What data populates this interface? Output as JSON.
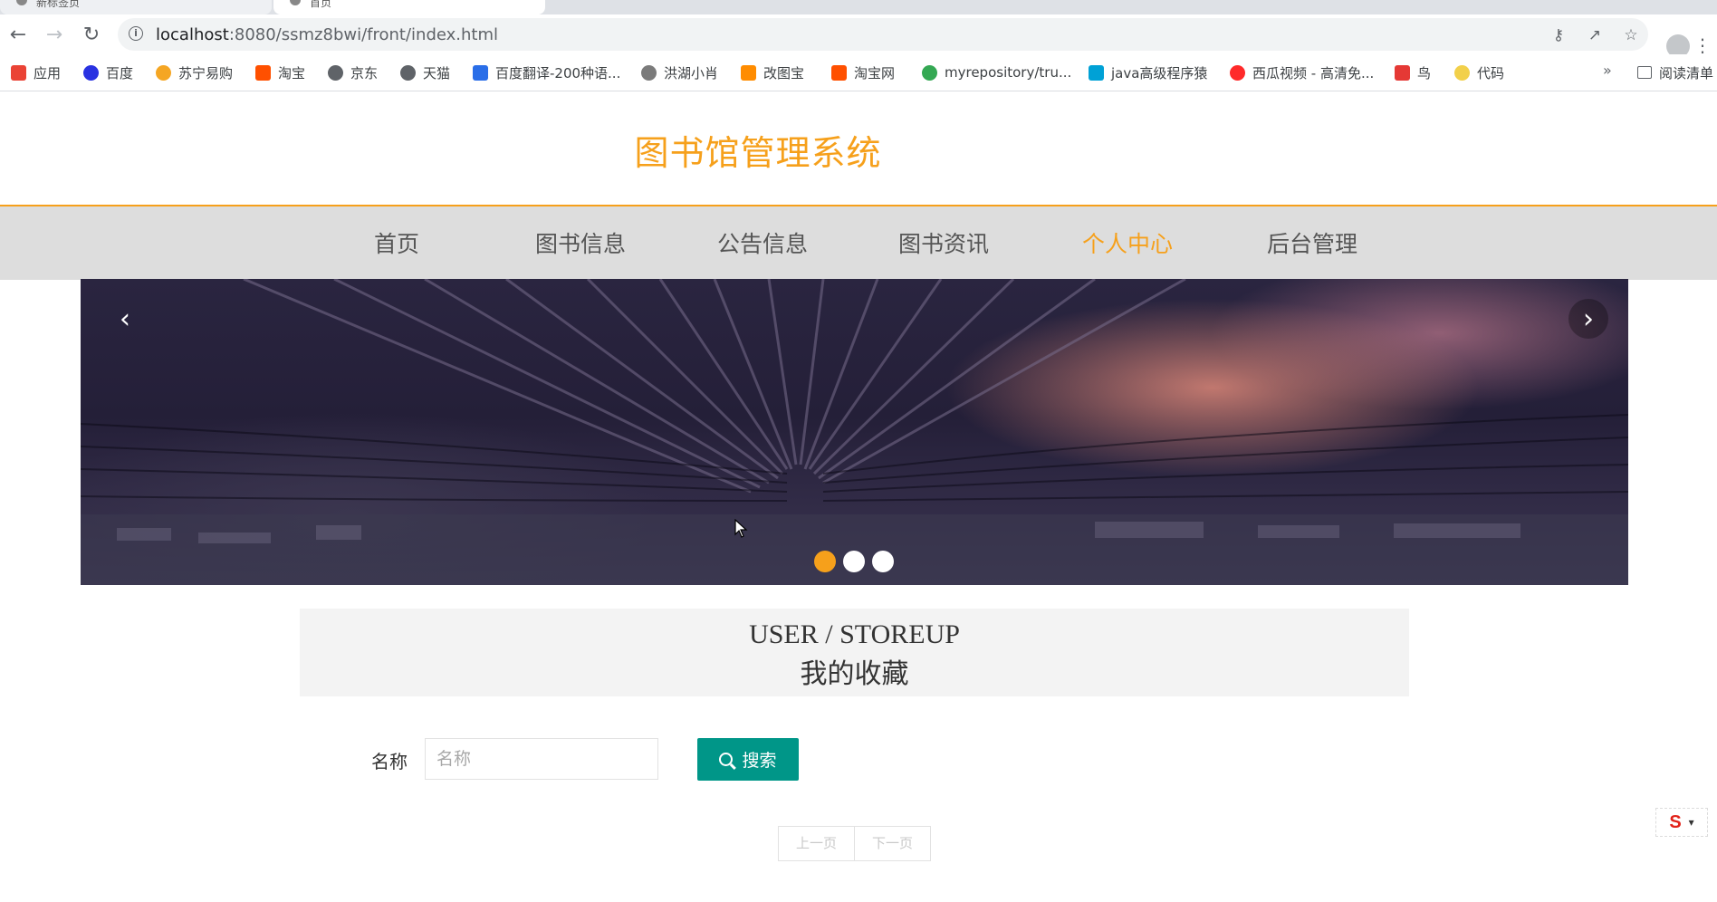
{
  "browser": {
    "tabs": [
      {
        "title": "新标签页"
      },
      {
        "title": "首页"
      }
    ],
    "url_host": "localhost",
    "url_path": ":8080/ssmz8bwi/front/index.html",
    "bookmarks": [
      {
        "label": "应用",
        "icon": "apps-grid-icon",
        "color": "#ea4335"
      },
      {
        "label": "百度",
        "icon": "baidu-paw-icon",
        "color": "#2932e1"
      },
      {
        "label": "苏宁易购",
        "icon": "suning-lion-icon",
        "color": "#f5a623"
      },
      {
        "label": "淘宝",
        "icon": "taobao-icon",
        "color": "#ff5000"
      },
      {
        "label": "京东",
        "icon": "globe-icon",
        "color": "#5f6368"
      },
      {
        "label": "天猫",
        "icon": "globe-icon",
        "color": "#5f6368"
      },
      {
        "label": "百度翻译-200种语...",
        "icon": "translate-icon",
        "color": "#2a6ee8"
      },
      {
        "label": "洪湖小肖",
        "icon": "bee-icon",
        "color": "#7b7b7b"
      },
      {
        "label": "改图宝",
        "icon": "gaitubao-icon",
        "color": "#ff8c00"
      },
      {
        "label": "淘宝网",
        "icon": "taobao-icon",
        "color": "#ff5000"
      },
      {
        "label": "myrepository/tru...",
        "icon": "chrome-icon",
        "color": "#34a853"
      },
      {
        "label": "java高级程序猿",
        "icon": "bilibili-icon",
        "color": "#00a1d6"
      },
      {
        "label": "西瓜视频 - 高清免...",
        "icon": "xigua-icon",
        "color": "#ff2a2a"
      },
      {
        "label": "鸟",
        "icon": "bird-icon",
        "color": "#e53935"
      },
      {
        "label": "代码",
        "icon": "code-icon",
        "color": "#f2d04a"
      }
    ],
    "more": "»",
    "reader_label": "阅读清单"
  },
  "site": {
    "title": "图书馆管理系统",
    "accent": "#f6a01b"
  },
  "nav": {
    "items": [
      {
        "label": "首页",
        "active": false
      },
      {
        "label": "图书信息",
        "active": false
      },
      {
        "label": "公告信息",
        "active": false
      },
      {
        "label": "图书资讯",
        "active": false
      },
      {
        "label": "个人中心",
        "active": true
      },
      {
        "label": "后台管理",
        "active": false
      }
    ]
  },
  "carousel": {
    "prev": "‹",
    "next": "›",
    "slide_count": 3,
    "active_slide": 1
  },
  "section": {
    "en": "USER / STOREUP",
    "cn": "我的收藏"
  },
  "search": {
    "label": "名称",
    "placeholder": "名称",
    "value": "",
    "button": "搜索",
    "button_color": "#009688"
  },
  "pager": {
    "prev": "上一页",
    "next": "下一页"
  }
}
